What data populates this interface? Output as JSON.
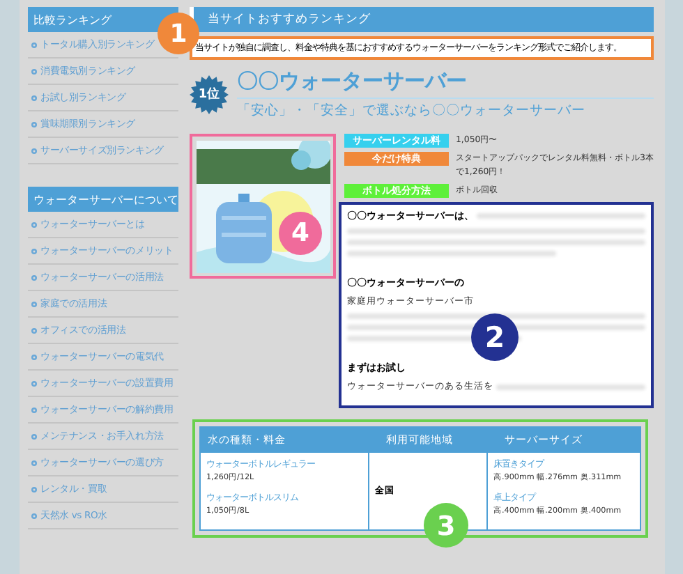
{
  "sidebar": {
    "sections": [
      {
        "title": "比較ランキング",
        "items": [
          "トータル購入別ランキング",
          "消費電気別ランキング",
          "お試し別ランキング",
          "賞味期限別ランキング",
          "サーバーサイズ別ランキング"
        ]
      },
      {
        "title": "ウォーターサーバーについて",
        "items": [
          "ウォーターサーバーとは",
          "ウォーターサーバーのメリット",
          "ウォーターサーバーの活用法",
          "家庭での活用法",
          "オフィスでの活用法",
          "ウォーターサーバーの電気代",
          "ウォーターサーバーの設置費用",
          "ウォーターサーバーの解約費用",
          "メンテナンス・お手入れ方法",
          "ウォーターサーバーの選び方",
          "レンタル・買取",
          "天然水 vs RO水"
        ]
      }
    ]
  },
  "main": {
    "heading": "当サイトおすすめランキング",
    "intro": {
      "text": "当サイトが独自に調査し、料金や特典を基におすすめするウォーターサーバーをランキング形式でご紹介します。",
      "callout": {
        "number": "1",
        "color": "#f0883a"
      }
    },
    "rank": "1位",
    "product_name": "〇〇ウォーターサーバー",
    "tagline": "「安心」・「安全」で選ぶなら〇〇ウォーターサーバー",
    "image": {
      "kind": "picture",
      "callout": {
        "number": "4",
        "color": "#f06b9b"
      }
    },
    "specs": [
      {
        "label": "サーバーレンタル料",
        "value": "1,050円〜",
        "color": "#36d0ee"
      },
      {
        "label": "今だけ特典",
        "value": "スタートアップパックでレンタル料無料・ボトル3本で1,260円！",
        "color": "#f0883a"
      },
      {
        "label": "ボトル処分方法",
        "value": "ボトル回収",
        "color": "#5ef03a"
      }
    ],
    "description": {
      "callout": {
        "number": "2",
        "color": "#233192"
      },
      "blocks": [
        {
          "heading": "〇〇ウォーターサーバーは、"
        },
        {
          "heading": "〇〇ウォーターサーバーの",
          "text": "家庭用ウォーターサーバー市"
        },
        {
          "heading": "まずはお試し",
          "text": "ウォーターサーバーのある生活を"
        }
      ]
    },
    "table": {
      "callout": {
        "number": "3",
        "color": "#6ad04f"
      },
      "columns": [
        "水の種類・料金",
        "利用可能地域",
        "サーバーサイズ"
      ],
      "water": [
        {
          "name": "ウォーターボトルレギュラー",
          "detail": "1,260円/12L"
        },
        {
          "name": "ウォーターボトルスリム",
          "detail": "1,050円/8L"
        }
      ],
      "area": "全国",
      "sizes": [
        {
          "name": "床置きタイプ",
          "detail": "高.900mm 幅.276mm 奥.311mm"
        },
        {
          "name": "卓上タイプ",
          "detail": "高.400mm 幅.200mm 奥.400mm"
        }
      ]
    }
  }
}
